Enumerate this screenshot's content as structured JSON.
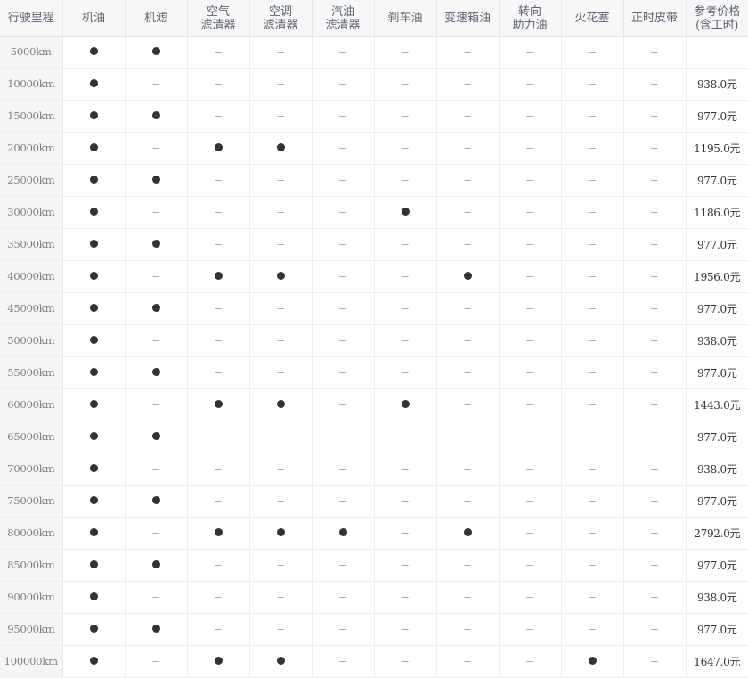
{
  "table": {
    "columns": [
      {
        "key": "mileage",
        "label": "行驶里程",
        "lines": [
          "行驶里程"
        ]
      },
      {
        "key": "engine_oil",
        "label": "机油",
        "lines": [
          "机油"
        ]
      },
      {
        "key": "oil_filter",
        "label": "机滤",
        "lines": [
          "机滤"
        ]
      },
      {
        "key": "air_filter",
        "label": "空气滤清器",
        "lines": [
          "空气",
          "滤清器"
        ]
      },
      {
        "key": "ac_filter",
        "label": "空调滤清器",
        "lines": [
          "空调",
          "滤清器"
        ]
      },
      {
        "key": "fuel_filter",
        "label": "汽油滤清器",
        "lines": [
          "汽油",
          "滤清器"
        ]
      },
      {
        "key": "brake_fluid",
        "label": "刹车油",
        "lines": [
          "刹车油"
        ]
      },
      {
        "key": "transmission_oil",
        "label": "变速箱油",
        "lines": [
          "变速箱油"
        ]
      },
      {
        "key": "power_steering",
        "label": "转向助力油",
        "lines": [
          "转向",
          "助力油"
        ]
      },
      {
        "key": "spark_plug",
        "label": "火花塞",
        "lines": [
          "火花塞"
        ]
      },
      {
        "key": "timing_belt",
        "label": "正时皮带",
        "lines": [
          "正时皮带"
        ]
      },
      {
        "key": "price",
        "label": "参考价格(含工时)",
        "lines": [
          "参考价格",
          "(含工时)"
        ]
      }
    ],
    "symbols": {
      "dot": "●",
      "dash": "–",
      "blank": ""
    },
    "rows": [
      {
        "mileage": "5000km",
        "marks": [
          "dot",
          "dot",
          "dash",
          "dash",
          "dash",
          "dash",
          "dash",
          "dash",
          "dash",
          "dash"
        ],
        "price": ""
      },
      {
        "mileage": "10000km",
        "marks": [
          "dot",
          "dash",
          "dash",
          "dash",
          "dash",
          "dash",
          "dash",
          "dash",
          "dash",
          "dash"
        ],
        "price": "938.0元"
      },
      {
        "mileage": "15000km",
        "marks": [
          "dot",
          "dot",
          "dash",
          "dash",
          "dash",
          "dash",
          "dash",
          "dash",
          "dash",
          "dash"
        ],
        "price": "977.0元"
      },
      {
        "mileage": "20000km",
        "marks": [
          "dot",
          "dash",
          "dot",
          "dot",
          "dash",
          "dash",
          "dash",
          "dash",
          "dash",
          "dash"
        ],
        "price": "1195.0元"
      },
      {
        "mileage": "25000km",
        "marks": [
          "dot",
          "dot",
          "dash",
          "dash",
          "dash",
          "dash",
          "dash",
          "dash",
          "dash",
          "dash"
        ],
        "price": "977.0元"
      },
      {
        "mileage": "30000km",
        "marks": [
          "dot",
          "dash",
          "dash",
          "dash",
          "dash",
          "dot",
          "dash",
          "dash",
          "dash",
          "dash"
        ],
        "price": "1186.0元"
      },
      {
        "mileage": "35000km",
        "marks": [
          "dot",
          "dot",
          "dash",
          "dash",
          "dash",
          "dash",
          "dash",
          "dash",
          "dash",
          "dash"
        ],
        "price": "977.0元"
      },
      {
        "mileage": "40000km",
        "marks": [
          "dot",
          "dash",
          "dot",
          "dot",
          "dash",
          "dash",
          "dot",
          "dash",
          "dash",
          "dash"
        ],
        "price": "1956.0元"
      },
      {
        "mileage": "45000km",
        "marks": [
          "dot",
          "dot",
          "dash",
          "dash",
          "dash",
          "dash",
          "dash",
          "dash",
          "dash",
          "dash"
        ],
        "price": "977.0元"
      },
      {
        "mileage": "50000km",
        "marks": [
          "dot",
          "dash",
          "dash",
          "dash",
          "dash",
          "dash",
          "dash",
          "dash",
          "dash",
          "dash"
        ],
        "price": "938.0元"
      },
      {
        "mileage": "55000km",
        "marks": [
          "dot",
          "dot",
          "dash",
          "dash",
          "dash",
          "dash",
          "dash",
          "dash",
          "dash",
          "dash"
        ],
        "price": "977.0元"
      },
      {
        "mileage": "60000km",
        "marks": [
          "dot",
          "dash",
          "dot",
          "dot",
          "dash",
          "dot",
          "dash",
          "dash",
          "dash",
          "dash"
        ],
        "price": "1443.0元"
      },
      {
        "mileage": "65000km",
        "marks": [
          "dot",
          "dot",
          "dash",
          "dash",
          "dash",
          "dash",
          "dash",
          "dash",
          "dash",
          "dash"
        ],
        "price": "977.0元"
      },
      {
        "mileage": "70000km",
        "marks": [
          "dot",
          "dash",
          "dash",
          "dash",
          "dash",
          "dash",
          "dash",
          "dash",
          "dash",
          "dash"
        ],
        "price": "938.0元"
      },
      {
        "mileage": "75000km",
        "marks": [
          "dot",
          "dot",
          "dash",
          "dash",
          "dash",
          "dash",
          "dash",
          "dash",
          "dash",
          "dash"
        ],
        "price": "977.0元"
      },
      {
        "mileage": "80000km",
        "marks": [
          "dot",
          "dash",
          "dot",
          "dot",
          "dot",
          "dash",
          "dot",
          "dash",
          "dash",
          "dash"
        ],
        "price": "2792.0元"
      },
      {
        "mileage": "85000km",
        "marks": [
          "dot",
          "dot",
          "dash",
          "dash",
          "dash",
          "dash",
          "dash",
          "dash",
          "dash",
          "dash"
        ],
        "price": "977.0元"
      },
      {
        "mileage": "90000km",
        "marks": [
          "dot",
          "dash",
          "dash",
          "dash",
          "dash",
          "dash",
          "dash",
          "dash",
          "dash",
          "dash"
        ],
        "price": "938.0元"
      },
      {
        "mileage": "95000km",
        "marks": [
          "dot",
          "dot",
          "dash",
          "dash",
          "dash",
          "dash",
          "dash",
          "dash",
          "dash",
          "dash"
        ],
        "price": "977.0元"
      },
      {
        "mileage": "100000km",
        "marks": [
          "dot",
          "dash",
          "dot",
          "dot",
          "dash",
          "dash",
          "dash",
          "dash",
          "dot",
          "dash"
        ],
        "price": "1647.0元"
      }
    ]
  },
  "colors": {
    "header_bg": "#f7f7f7",
    "header_text": "#5b6472",
    "mileage_bg": "#f5f5f5",
    "mileage_text": "#7a7f88",
    "dot": "#333333",
    "dash": "#9aa0a8",
    "price_text": "#333333",
    "border": "#eeeeee"
  }
}
